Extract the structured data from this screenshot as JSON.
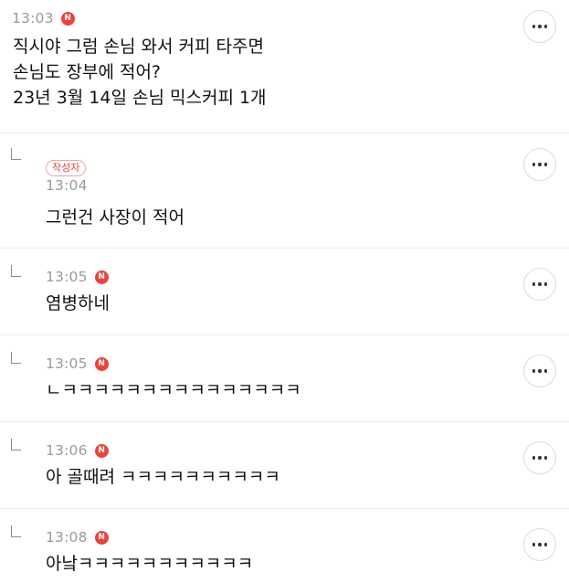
{
  "comments": [
    {
      "time": "13:03",
      "badge": "N",
      "text": "직시야 그럼 손님 와서 커피 타주면\n손님도 장부에 적어?\n23년 3월 14일 손님 믹스커피 1개"
    },
    {
      "author_label": "작성자",
      "time": "13:04",
      "text": "그런건 사장이 적어"
    },
    {
      "time": "13:05",
      "badge": "N",
      "text": "염병하네"
    },
    {
      "time": "13:05",
      "badge": "N",
      "text": "ㄴㅋㅋㅋㅋㅋㅋㅋㅋㅋㅋㅋㅋㅋㅋㅋ"
    },
    {
      "time": "13:06",
      "badge": "N",
      "text": "아 골때려 ㅋㅋㅋㅋㅋㅋㅋㅋㅋㅋ"
    },
    {
      "time": "13:08",
      "badge": "N",
      "text": "아낰ㅋㅋㅋㅋㅋㅋㅋㅋㅋㅋㅋ"
    }
  ],
  "icons": {
    "more": "more-horizontal-icon",
    "reply": "reply-corner-icon",
    "new_badge": "new-badge-icon"
  },
  "colors": {
    "badge": "#e8443b",
    "time": "#9a9a9a",
    "divider": "#ececec"
  }
}
